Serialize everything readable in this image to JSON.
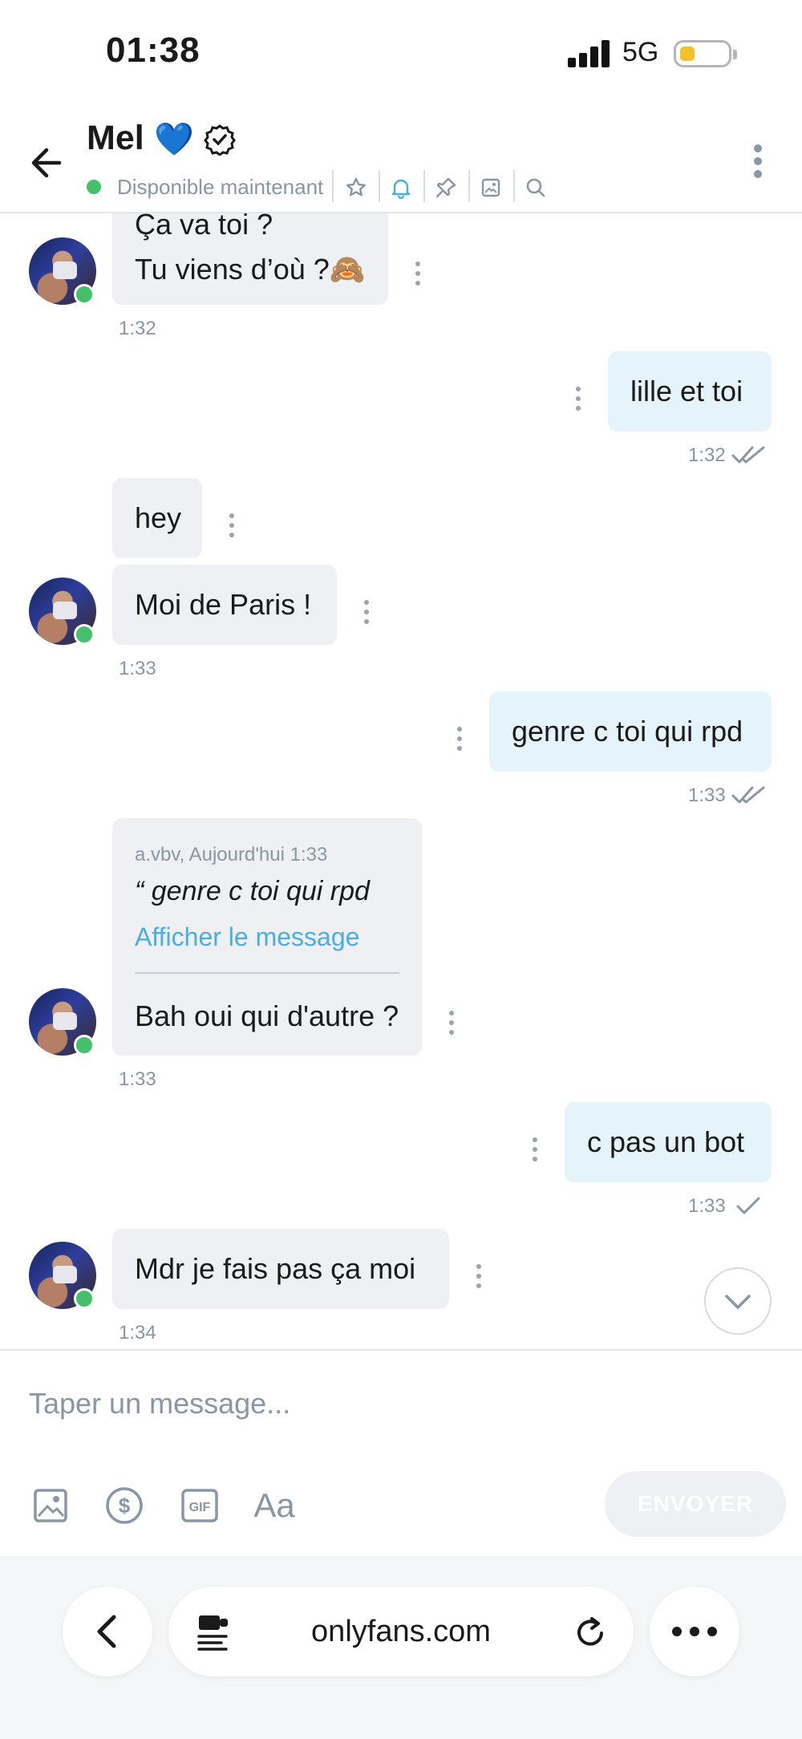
{
  "status_bar": {
    "time": "01:38",
    "network": "5G"
  },
  "header": {
    "name": "Mel",
    "heart": "💙",
    "status": "Disponible maintenant",
    "icons": [
      "star-icon",
      "bell-icon",
      "pin-icon",
      "image-icon",
      "search-icon"
    ]
  },
  "messages": [
    {
      "dir": "in",
      "lines": [
        "Ça va toi ?",
        "Tu viens d’où ?🙈"
      ],
      "time": "1:32"
    },
    {
      "dir": "out",
      "text": "lille et toi",
      "time": "1:32",
      "status": "read"
    },
    {
      "dir": "in",
      "text": "hey"
    },
    {
      "dir": "in",
      "text": "Moi de Paris !",
      "time": "1:33"
    },
    {
      "dir": "out",
      "text": "genre c toi qui rpd",
      "time": "1:33",
      "status": "read"
    },
    {
      "dir": "in",
      "quote": {
        "author": "a.vbv, Aujourd'hui 1:33",
        "text": "“ genre c toi qui rpd",
        "link": "Afficher le message"
      },
      "text": "Bah oui qui d'autre ?",
      "time": "1:33"
    },
    {
      "dir": "out",
      "text": "c pas un bot",
      "time": "1:33",
      "status": "sent"
    },
    {
      "dir": "in",
      "text": "Mdr je fais pas ça moi",
      "time": "1:34"
    }
  ],
  "composer": {
    "placeholder": "Taper un message...",
    "send_label": "ENVOYER",
    "tools": [
      "image-icon",
      "dollar-icon",
      "gif-icon",
      "text-format-icon"
    ],
    "font_tool_label": "Aa"
  },
  "browser": {
    "url": "onlyfans.com"
  },
  "colors": {
    "outgoing_bubble": "#e5f4fb",
    "incoming_bubble": "#eef0f3",
    "accent": "#4aaee4",
    "online": "#45c06a"
  }
}
